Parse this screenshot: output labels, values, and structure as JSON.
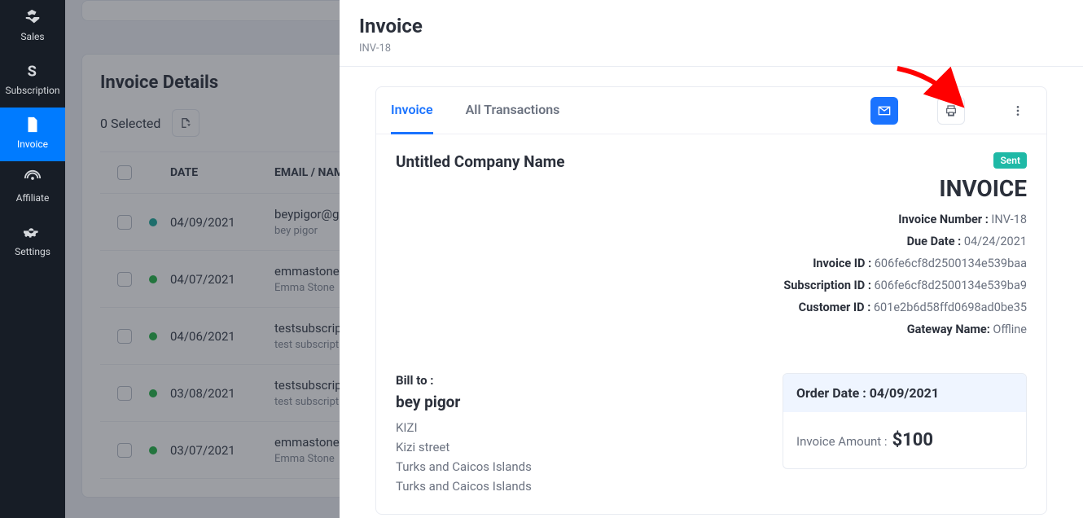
{
  "sidebar": {
    "items": [
      {
        "label": "Sales"
      },
      {
        "label": "Subscription"
      },
      {
        "label": "Invoice"
      },
      {
        "label": "Affiliate"
      },
      {
        "label": "Settings"
      }
    ]
  },
  "list": {
    "title": "Invoice Details",
    "selected_text": "0 Selected",
    "headers": {
      "date": "DATE",
      "email": "EMAIL / NAME"
    },
    "rows": [
      {
        "dot": "teal",
        "date": "04/09/2021",
        "email": "beypigor@g",
        "name": "bey pigor"
      },
      {
        "dot": "green",
        "date": "04/07/2021",
        "email": "emmastone",
        "name": "Emma Stone"
      },
      {
        "dot": "green",
        "date": "04/06/2021",
        "email": "testsubscrip",
        "name": "test subscriptio"
      },
      {
        "dot": "green",
        "date": "03/08/2021",
        "email": "testsubscrip",
        "name": "test subscriptio"
      },
      {
        "dot": "green",
        "date": "03/07/2021",
        "email": "emmastone",
        "name": "Emma Stone"
      }
    ]
  },
  "panel": {
    "title": "Invoice",
    "code": "INV-18",
    "tabs": {
      "invoice": "Invoice",
      "all": "All Transactions"
    },
    "company": "Untitled Company Name",
    "status": "Sent",
    "doc_title": "INVOICE",
    "meta": {
      "invoice_number_label": "Invoice Number :",
      "invoice_number": "INV-18",
      "due_date_label": "Due Date :",
      "due_date": "04/24/2021",
      "invoice_id_label": "Invoice ID :",
      "invoice_id": "606fe6cf8d2500134e539baa",
      "subscription_id_label": "Subscription ID :",
      "subscription_id": "606fe6cf8d2500134e539ba9",
      "customer_id_label": "Customer ID :",
      "customer_id": "601e2b6d58ffd0698ad0be35",
      "gateway_label": "Gateway Name:",
      "gateway": "Offline"
    },
    "bill_to": {
      "label": "Bill to :",
      "name": "bey pigor",
      "line1": "KIZI",
      "line2": "Kizi street",
      "line3": "Turks and Caicos Islands",
      "line4": "Turks and Caicos Islands"
    },
    "amount": {
      "order_date_label": "Order Date :",
      "order_date": "04/09/2021",
      "inv_amount_label": "Invoice Amount :",
      "inv_amount": "$100"
    }
  }
}
